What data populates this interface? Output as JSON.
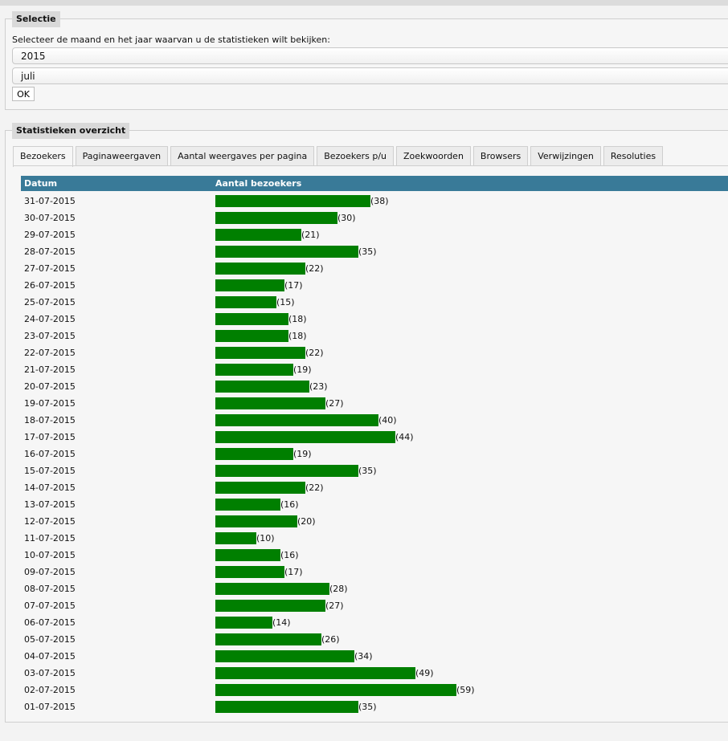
{
  "selection": {
    "legend": "Selectie",
    "prompt": "Selecteer de maand en het jaar waarvan u de statistieken wilt bekijken:",
    "year": "2015",
    "month": "juli",
    "ok_label": "OK"
  },
  "overview": {
    "legend": "Statistieken overzicht",
    "tabs": [
      "Bezoekers",
      "Paginaweergaven",
      "Aantal weergaves per pagina",
      "Bezoekers p/u",
      "Zoekwoorden",
      "Browsers",
      "Verwijzingen",
      "Resoluties"
    ],
    "active_tab": 0,
    "table": {
      "col_date": "Datum",
      "col_visitors": "Aantal bezoekers"
    },
    "colors": {
      "bar": "#007f00",
      "header": "#397a98"
    }
  },
  "chart_data": {
    "type": "bar",
    "orientation": "horizontal",
    "categories": [
      "31-07-2015",
      "30-07-2015",
      "29-07-2015",
      "28-07-2015",
      "27-07-2015",
      "26-07-2015",
      "25-07-2015",
      "24-07-2015",
      "23-07-2015",
      "22-07-2015",
      "21-07-2015",
      "20-07-2015",
      "19-07-2015",
      "18-07-2015",
      "17-07-2015",
      "16-07-2015",
      "15-07-2015",
      "14-07-2015",
      "13-07-2015",
      "12-07-2015",
      "11-07-2015",
      "10-07-2015",
      "09-07-2015",
      "08-07-2015",
      "07-07-2015",
      "06-07-2015",
      "05-07-2015",
      "04-07-2015",
      "03-07-2015",
      "02-07-2015",
      "01-07-2015"
    ],
    "values": [
      38,
      30,
      21,
      35,
      22,
      17,
      15,
      18,
      18,
      22,
      19,
      23,
      27,
      40,
      44,
      19,
      35,
      22,
      16,
      20,
      10,
      16,
      17,
      28,
      27,
      14,
      26,
      34,
      49,
      59,
      35
    ],
    "value_labels": [
      "(38)",
      "(30)",
      "(21)",
      "(35)",
      "(22)",
      "(17)",
      "(15)",
      "(18)",
      "(18)",
      "(22)",
      "(19)",
      "(23)",
      "(27)",
      "(40)",
      "(44)",
      "(19)",
      "(35)",
      "(22)",
      "(16)",
      "(20)",
      "(10)",
      "(16)",
      "(17)",
      "(28)",
      "(27)",
      "(14)",
      "(26)",
      "(34)",
      "(49)",
      "(59)",
      "(35)"
    ]
  }
}
